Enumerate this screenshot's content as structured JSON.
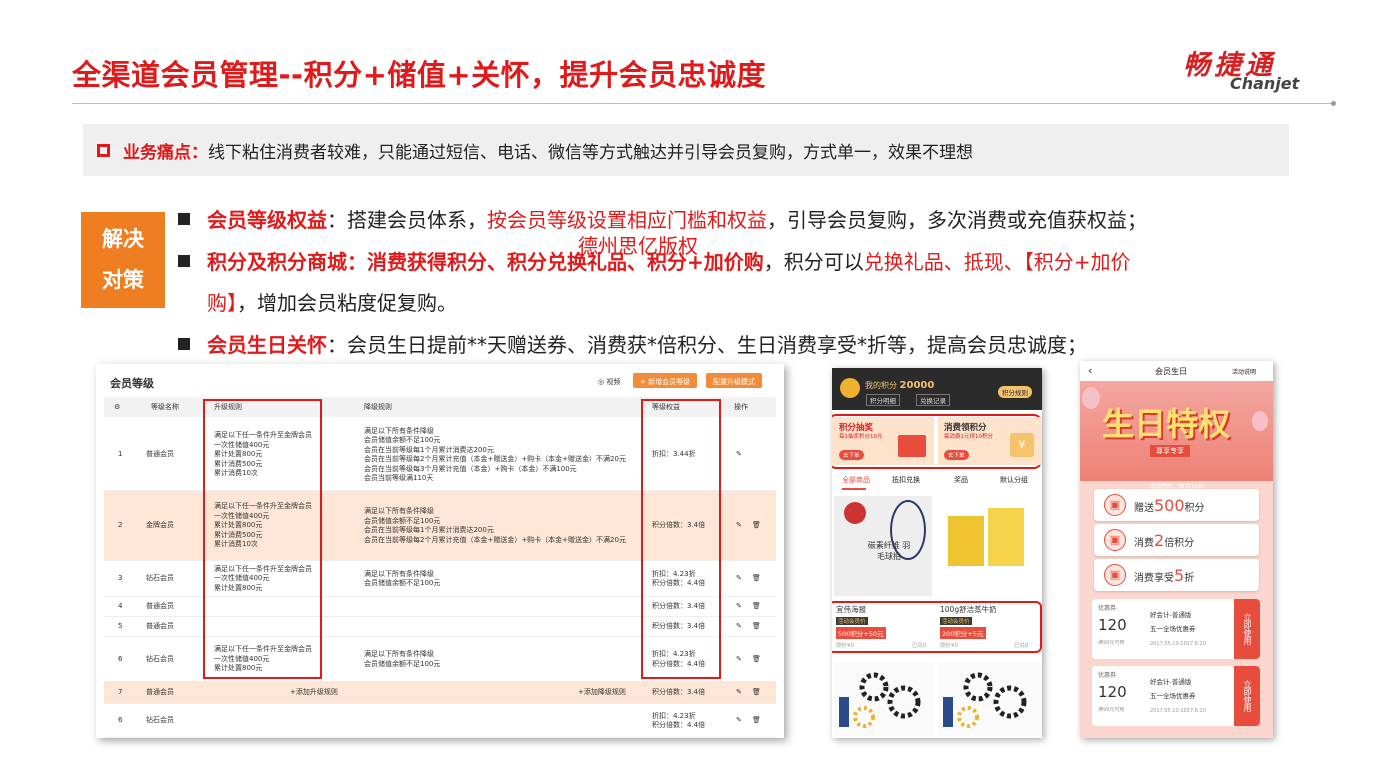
{
  "header": {
    "title": "全渠道会员管理--积分+储值+关怀，提升会员忠诚度",
    "logo_cn": "畅捷通",
    "logo_en": "Chanjet"
  },
  "pain": {
    "label": "业务痛点：",
    "text": "线下粘住消费者较难，只能通过短信、电话、微信等方式触达并引导会员复购，方式单一，效果不理想"
  },
  "badge": {
    "line1": "解决",
    "line2": "对策"
  },
  "bullets": {
    "b1_label": "会员等级权益",
    "b1_a": "：搭建会员体系，",
    "b1_red": "按会员等级设置相应门槛和权益",
    "b1_b": "，引导会员复购，多次消费或充值获权益；",
    "b2_label": "积分及积分商城：消费获得积分、积分兑换礼品、积分+加价购",
    "b2_a": "，积分可以",
    "b2_red": "兑换礼品、抵现、【积分+加价",
    "b2_red2": "购】",
    "b2_b": "，增加会员粘度促复购。",
    "b3_label": "会员生日关怀",
    "b3_a": "：会员生日提前**天赠送券、消费获*倍积分、生日消费享受*折等，提高会员忠诚度；"
  },
  "watermark": "德州思亿版权",
  "level_panel": {
    "title": "会员等级",
    "video": "◎ 视频",
    "btn_add": "+ 新增会员等级",
    "btn_config": "配置升级模式",
    "cols": {
      "name": "等级名称",
      "up": "升级规则",
      "down": "降级规则",
      "rights": "等级权益",
      "ops": "操作"
    },
    "rows": [
      {
        "no": "1",
        "name": "普通会员",
        "up": "满足以下任一条件升至金牌会员\n一次性储值400元\n累计处置800元\n累计消费500元\n累计消费10次",
        "down": "满足以下所有条件降级\n会员储值余额不足100元\n会员在当前等级每1个月累计消费达200元\n会员在当前等级每2个月累计充值（本金+赠送金）+购卡（本金+赠送金）不满20元\n会员在当前等级每3个月累计充值（本金）+购卡（本金）不满100元\n会员当前等级满110天",
        "rights": "折扣：3.44折"
      },
      {
        "no": "2",
        "name": "金牌会员",
        "up": "满足以下任一条件升至金牌会员\n一次性储值400元\n累计处置800元\n累计消费500元\n累计消费10次",
        "down": "满足以下所有条件降级\n会员储值余额不足100元\n会员在当前等级每1个月累计消费达200元\n会员在当前等级每2个月累计充值（本金+赠送金）+购卡（本金+赠送金）不满20元",
        "rights": "积分倍数：3.4倍"
      },
      {
        "no": "3",
        "name": "钻石会员",
        "up": "满足以下任一条件升至金牌会员\n一次性储值400元\n累计处置800元",
        "down": "满足以下所有条件降级\n会员储值余额不足100元",
        "rights": "折扣：4.23折\n积分倍数：4.4倍"
      },
      {
        "no": "4",
        "name": "普通会员",
        "up": "",
        "down": "",
        "rights": "积分倍数：3.4倍"
      },
      {
        "no": "5",
        "name": "普通会员",
        "up": "",
        "down": "",
        "rights": "积分倍数：3.4倍"
      },
      {
        "no": "6",
        "name": "钻石会员",
        "up": "满足以下任一条件升至金牌会员\n一次性储值400元\n累计处置800元",
        "down": "满足以下所有条件降级\n会员储值余额不足100元",
        "rights": "折扣：4.23折\n积分倍数：4.4倍"
      },
      {
        "no": "7",
        "name": "普通会员",
        "up": "+添加升级规则",
        "down": "+添加降级规则",
        "rights": "积分倍数：3.4倍"
      },
      {
        "no": "6",
        "name": "钻石会员",
        "up": "",
        "down": "",
        "rights": "折扣：4.23折\n积分倍数：4.4倍"
      }
    ]
  },
  "mall_panel": {
    "my_points_label": "我的积分",
    "my_points": "20000",
    "detail": "积分明细",
    "exchange": "兑换记录",
    "rule": "积分规则",
    "card1_title": "积分抽奖",
    "card1_sub": "每1抽奖积分10元",
    "card1_btn": "去下单",
    "card2_title": "消费领积分",
    "card2_sub": "每消费1元得10积分",
    "card2_btn": "去下单",
    "tabs": [
      "全部商品",
      "抵扣兑换",
      "奖品",
      "默认分组"
    ],
    "prod1_img": "碳素纤维 羽毛球拍",
    "prod1_name": "宜伟海报",
    "prod1_tag": "活动会员价",
    "prod1_price": "500积分+50元",
    "prod1_orig": "原价¥0",
    "prod1_sold": "已兑0",
    "prod2_name": "100g舒洁蒸牛奶",
    "prod2_tag": "活动会员价",
    "prod2_price": "200积分+5元",
    "prod2_orig": "原价¥0",
    "prod2_sold": "已兑0"
  },
  "birthday_panel": {
    "nav_title": "会员生日",
    "nav_right": "活动说明",
    "banner": "生日特权",
    "banner_sub": "尊享专享",
    "activity_time": "活动时间：每月15日",
    "gift1_a": "赠送",
    "gift1_num": "500",
    "gift1_b": "积分",
    "gift2_a": "消费",
    "gift2_num": "2",
    "gift2_b": "倍积分",
    "gift3_a": "消费享受",
    "gift3_num": "5",
    "gift3_b": "折",
    "coupon1": {
      "type": "优惠券",
      "value": "120",
      "cond": "满99元可用",
      "brand": "好会计-普通版",
      "name": "五一全场优惠券",
      "date": "2017.05.10-2017.6.20",
      "use": "立即使用"
    },
    "coupon2": {
      "type": "优惠券",
      "value": "120",
      "cond": "满99元可用",
      "brand": "好会计-普通版",
      "name": "五一全场优惠券",
      "date": "2017.05.10-2017.6.20",
      "use": "立即使用"
    }
  },
  "colors": {
    "accent": "#e01a1a",
    "orange": "#ef7d22"
  }
}
